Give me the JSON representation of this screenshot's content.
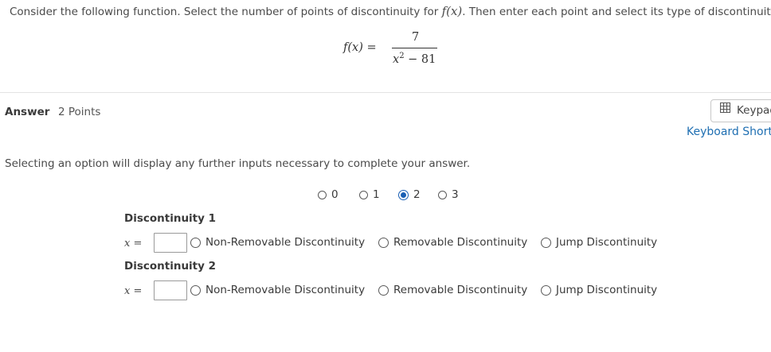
{
  "question": {
    "text_prefix": "Consider the following function. Select the number of points of discontinuity for ",
    "fx": "f(x)",
    "text_suffix": ". Then enter each point and select its type of discontinuity."
  },
  "formula": {
    "lhs": "f(x) =",
    "numerator": "7",
    "denominator_var": "x",
    "denominator_exp": "2",
    "denominator_rest": " − 81"
  },
  "answer": {
    "label": "Answer",
    "points": "2 Points"
  },
  "keypad": {
    "label": "Keypad",
    "shortcuts": "Keyboard Shortcuts",
    "icon": "keypad-icon"
  },
  "hint": "Selecting an option will display any further inputs necessary to complete your answer.",
  "count_options": [
    {
      "label": "0",
      "selected": false
    },
    {
      "label": "1",
      "selected": false
    },
    {
      "label": "2",
      "selected": true
    },
    {
      "label": "3",
      "selected": false
    }
  ],
  "discontinuities": [
    {
      "title": "Discontinuity 1",
      "x_label": "x",
      "eq": "=",
      "value": "",
      "types": [
        "Non-Removable Discontinuity",
        "Removable Discontinuity",
        "Jump Discontinuity"
      ]
    },
    {
      "title": "Discontinuity 2",
      "x_label": "x",
      "eq": "=",
      "value": "",
      "types": [
        "Non-Removable Discontinuity",
        "Removable Discontinuity",
        "Jump Discontinuity"
      ]
    }
  ],
  "colors": {
    "accent": "#1a5fb4",
    "link": "#1f6fb2",
    "divider": "#e3e3e3"
  }
}
